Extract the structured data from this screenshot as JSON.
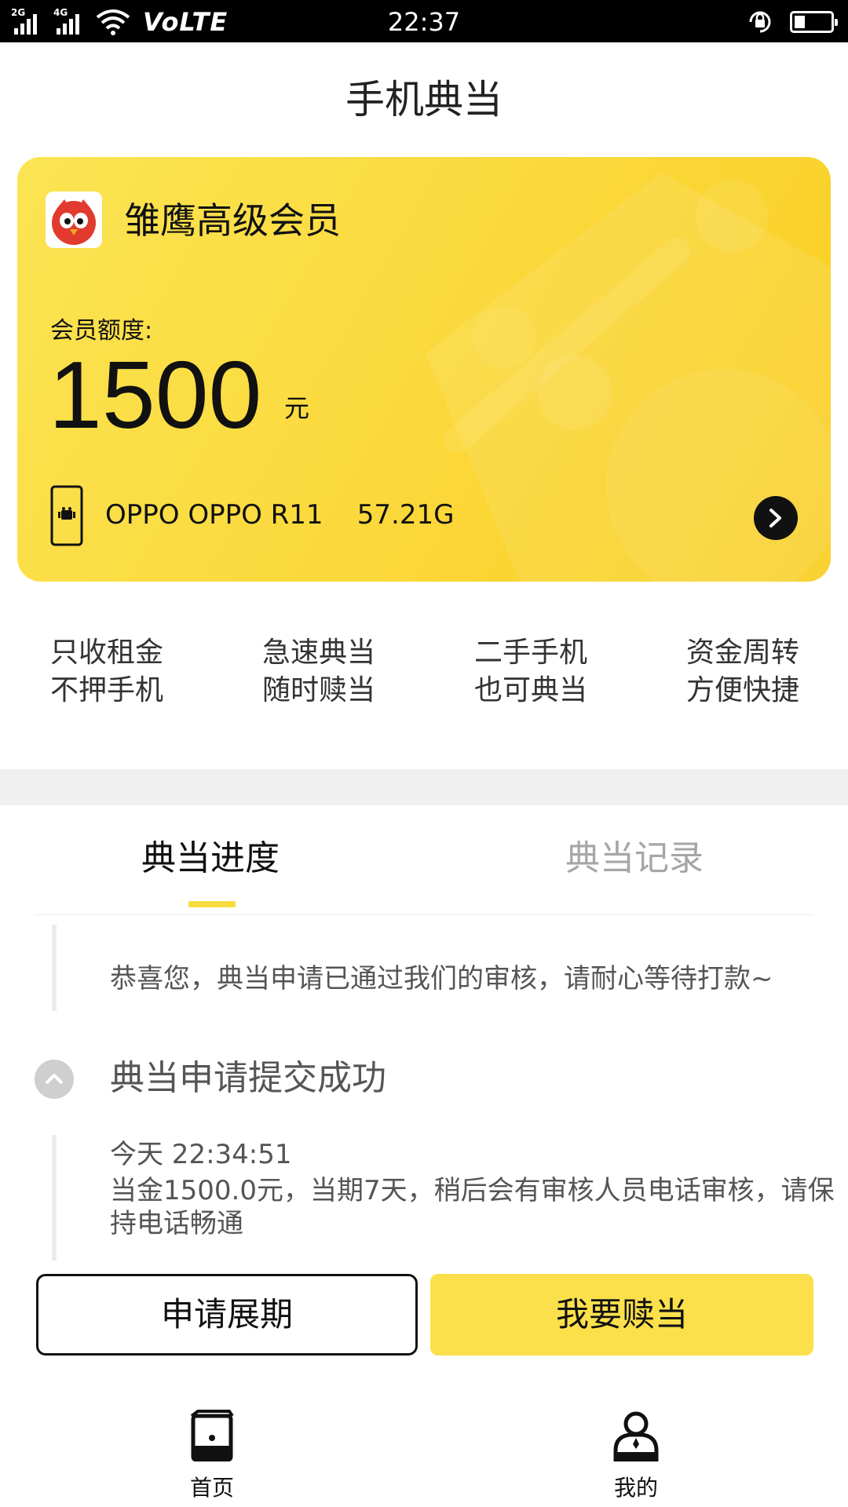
{
  "status_bar": {
    "sim1_gen": "2G",
    "sim2_gen": "4G",
    "volte": "VoLTE",
    "time": "22:37",
    "battery_level": 0.3
  },
  "header": {
    "title": "手机典当"
  },
  "member_card": {
    "level": "雏鹰高级会员",
    "quota_label": "会员额度:",
    "quota_value": "1500",
    "quota_unit": "元",
    "device": "OPPO OPPO R11    57.21G",
    "colors": {
      "card": "#fbd83a",
      "accent": "#fbe04b"
    }
  },
  "features": [
    {
      "line1": "只收租金",
      "line2": "不押手机"
    },
    {
      "line1": "急速典当",
      "line2": "随时赎当"
    },
    {
      "line1": "二手手机",
      "line2": "也可典当"
    },
    {
      "line1": "资金周转",
      "line2": "方便快捷"
    }
  ],
  "tabs": [
    {
      "label": "典当进度",
      "active": true
    },
    {
      "label": "典当记录",
      "active": false
    }
  ],
  "timeline": {
    "approved_message": "恭喜您，典当申请已通过我们的审核，请耐心等待打款~",
    "submitted_title": "典当申请提交成功",
    "submitted_time": "今天 22:34:51",
    "submitted_desc": "当金1500.0元，当期7天，稍后会有审核人员电话审核，请保持电话畅通"
  },
  "actions": {
    "extend_label": "申请展期",
    "redeem_label": "我要赎当"
  },
  "bottom_nav": [
    {
      "label": "首页",
      "icon": "home-phone-icon"
    },
    {
      "label": "我的",
      "icon": "profile-icon"
    }
  ]
}
